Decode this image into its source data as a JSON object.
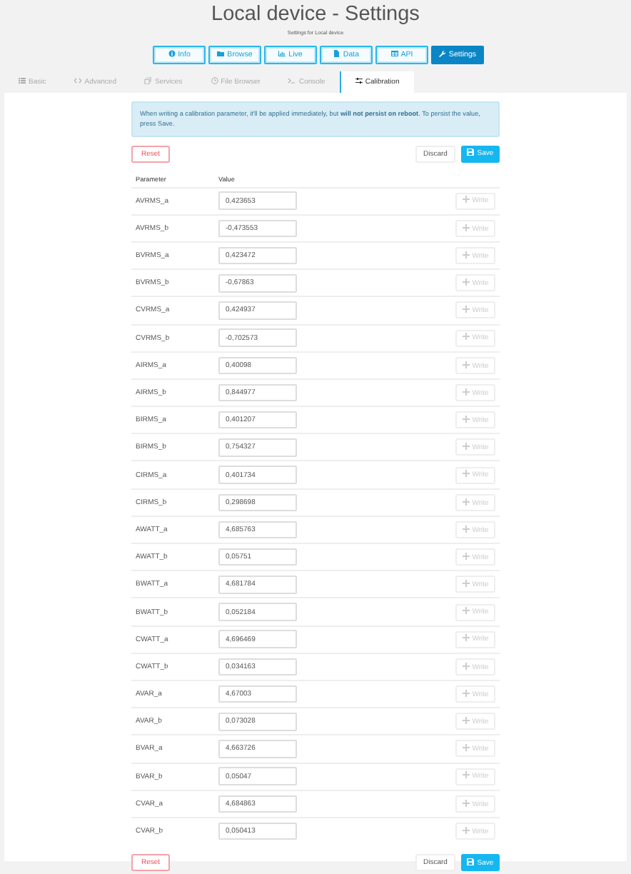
{
  "page": {
    "title": "Local device - Settings",
    "subtitle": "Settings for Local device"
  },
  "nav": [
    {
      "label": "Info",
      "selected": false
    },
    {
      "label": "Browse",
      "selected": false
    },
    {
      "label": "Live",
      "selected": false
    },
    {
      "label": "Data",
      "selected": false
    },
    {
      "label": "API",
      "selected": false
    },
    {
      "label": "Settings",
      "selected": true
    }
  ],
  "tabs": [
    {
      "label": "Basic",
      "selected": false
    },
    {
      "label": "Advanced",
      "selected": false
    },
    {
      "label": "Services",
      "selected": false
    },
    {
      "label": "File Browser",
      "selected": false
    },
    {
      "label": "Console",
      "selected": false
    },
    {
      "label": "Calibration",
      "selected": true
    }
  ],
  "alert": "When writing a calibration parameter, it'll be applied immediately, but **will not persist on reboot**. To persist the value, press Save.",
  "actions": {
    "reset": "Reset",
    "discard": "Discard",
    "save": "Save"
  },
  "table": {
    "columns": [
      "Parameter",
      "Value"
    ],
    "rows": [
      {
        "parameter": "AVRMS_a",
        "value": "0,423653",
        "write": "Write",
        "disabled": true
      },
      {
        "parameter": "AVRMS_b",
        "value": "-0,473553",
        "write": "Write",
        "disabled": true
      },
      {
        "parameter": "BVRMS_a",
        "value": "0,423472",
        "write": "Write",
        "disabled": true
      },
      {
        "parameter": "BVRMS_b",
        "value": "-0,67863",
        "write": "Write",
        "disabled": true
      },
      {
        "parameter": "CVRMS_a",
        "value": "0,424937",
        "write": "Write",
        "disabled": true
      },
      {
        "parameter": "CVRMS_b",
        "value": "-0,702573",
        "write": "Write",
        "disabled": true
      },
      {
        "parameter": "AIRMS_a",
        "value": "0,40098",
        "write": "Write",
        "disabled": true
      },
      {
        "parameter": "AIRMS_b",
        "value": "0,844977",
        "write": "Write",
        "disabled": true
      },
      {
        "parameter": "BIRMS_a",
        "value": "0,401207",
        "write": "Write",
        "disabled": true
      },
      {
        "parameter": "BIRMS_b",
        "value": "0,754327",
        "write": "Write",
        "disabled": true
      },
      {
        "parameter": "CIRMS_a",
        "value": "0,401734",
        "write": "Write",
        "disabled": true
      },
      {
        "parameter": "CIRMS_b",
        "value": "0,298698",
        "write": "Write",
        "disabled": true
      },
      {
        "parameter": "AWATT_a",
        "value": "4,685763",
        "write": "Write",
        "disabled": true
      },
      {
        "parameter": "AWATT_b",
        "value": "0,05751",
        "write": "Write",
        "disabled": true
      },
      {
        "parameter": "BWATT_a",
        "value": "4,681784",
        "write": "Write",
        "disabled": true
      },
      {
        "parameter": "BWATT_b",
        "value": "0,052184",
        "write": "Write",
        "disabled": true
      },
      {
        "parameter": "CWATT_a",
        "value": "4,696469",
        "write": "Write",
        "disabled": true
      },
      {
        "parameter": "CWATT_b",
        "value": "0,034163",
        "write": "Write",
        "disabled": true
      },
      {
        "parameter": "AVAR_a",
        "value": "4,67003",
        "write": "Write",
        "disabled": true
      },
      {
        "parameter": "AVAR_b",
        "value": "0,073028",
        "write": "Write",
        "disabled": true
      },
      {
        "parameter": "BVAR_a",
        "value": "4,663726",
        "write": "Write",
        "disabled": true
      },
      {
        "parameter": "BVAR_b",
        "value": "0,05047",
        "write": "Write",
        "disabled": true
      },
      {
        "parameter": "CVAR_a",
        "value": "4,684863",
        "write": "Write",
        "disabled": true
      },
      {
        "parameter": "CVAR_b",
        "value": "0,050413",
        "write": "Write",
        "disabled": true
      }
    ]
  },
  "bottom_actions": {
    "reset": "Reset",
    "discard": "Discard",
    "save": "Save"
  }
}
